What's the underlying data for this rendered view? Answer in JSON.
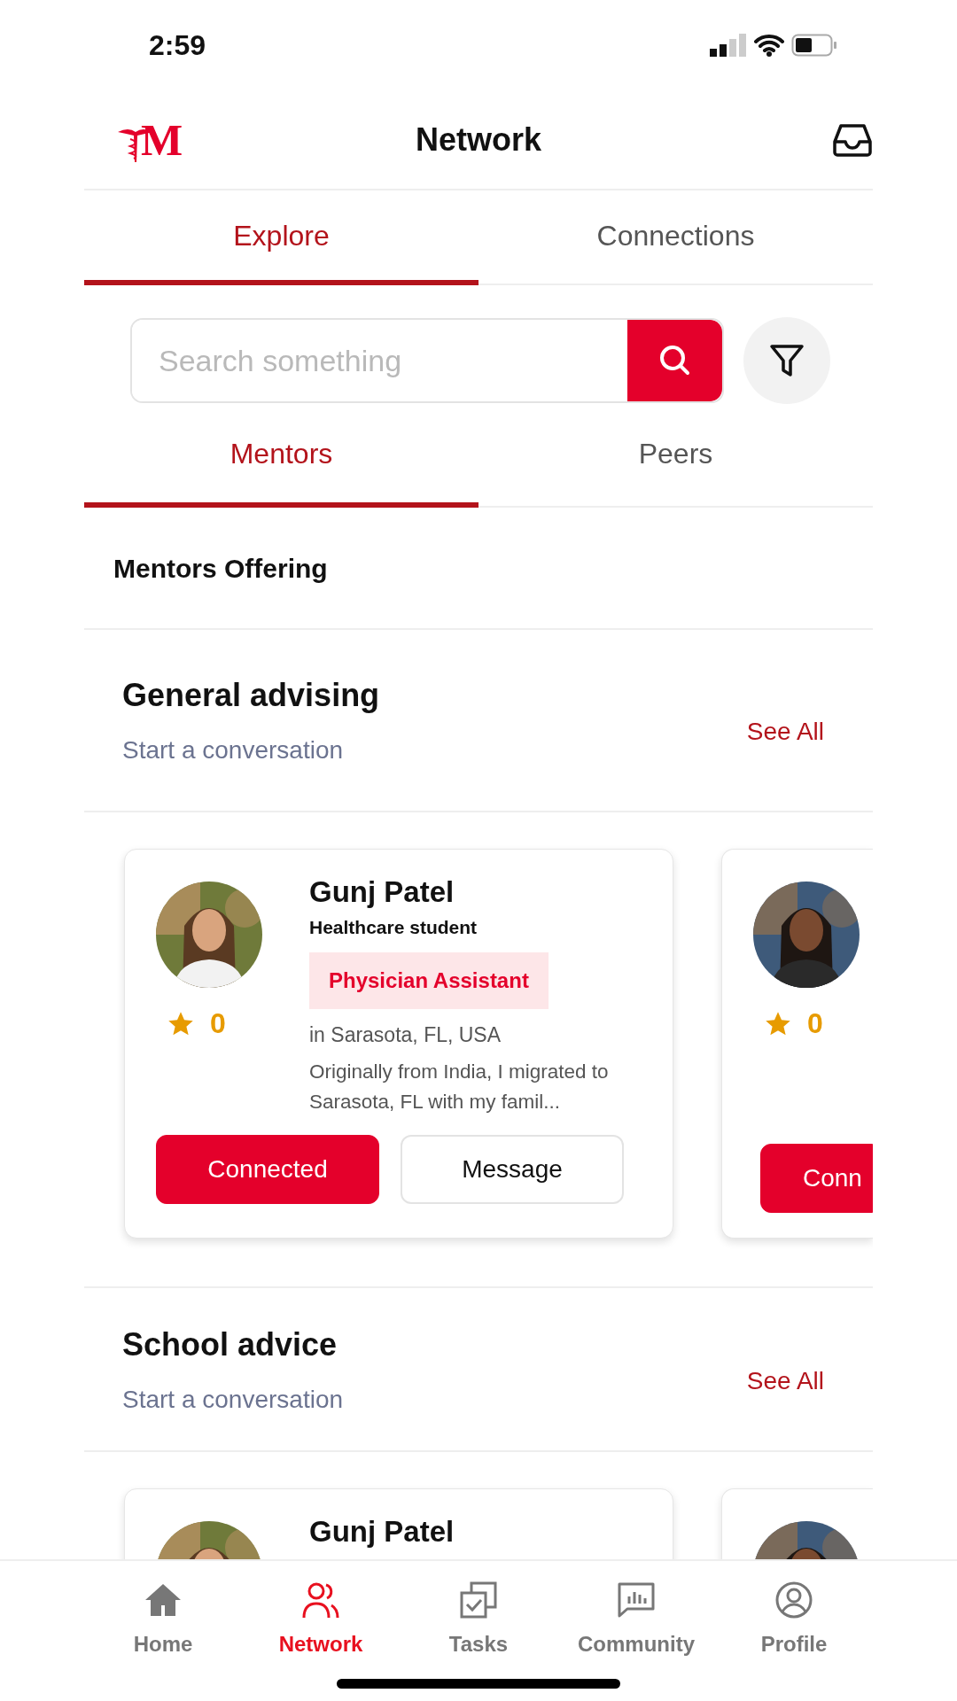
{
  "status_bar": {
    "time": "2:59"
  },
  "header": {
    "logo_text": "M",
    "title": "Network"
  },
  "tabs": [
    {
      "label": "Explore",
      "selected": true
    },
    {
      "label": "Connections",
      "selected": false
    }
  ],
  "search": {
    "placeholder": "Search something"
  },
  "sub_tabs": [
    {
      "label": "Mentors",
      "selected": true
    },
    {
      "label": "Peers",
      "selected": false
    }
  ],
  "section_heading": "Mentors Offering",
  "sections": [
    {
      "title": "General advising",
      "subtitle": "Start a conversation",
      "link": "See All",
      "cards": [
        {
          "avatar": {
            "kind": "picture"
          },
          "rating": "0",
          "name": "Gunj Patel",
          "role": "Healthcare student",
          "tag": "Physician Assistant",
          "location": "in Sarasota, FL, USA",
          "bio": "Originally from India, I migrated to Sarasota, FL with my famil...",
          "buttons": [
            {
              "label": "Connected",
              "kind": "filled"
            },
            {
              "label": "Message",
              "kind": "outline"
            }
          ]
        },
        {
          "partial": true,
          "avatar": {
            "kind": "picture"
          },
          "rating": "0",
          "buttons": [
            {
              "label": "Conn",
              "kind": "filled"
            }
          ]
        }
      ]
    },
    {
      "title": "School advice",
      "subtitle": "Start a conversation",
      "link": "See All",
      "cards": [
        {
          "avatar": {
            "kind": "picture"
          },
          "name": "Gunj Patel"
        },
        {
          "partial": true,
          "avatar": {
            "kind": "picture"
          }
        }
      ]
    }
  ],
  "nav": [
    {
      "label": "Home",
      "selected": false
    },
    {
      "label": "Network",
      "selected": true
    },
    {
      "label": "Tasks",
      "selected": false
    },
    {
      "label": "Community",
      "selected": false
    },
    {
      "label": "Profile",
      "selected": false
    }
  ]
}
